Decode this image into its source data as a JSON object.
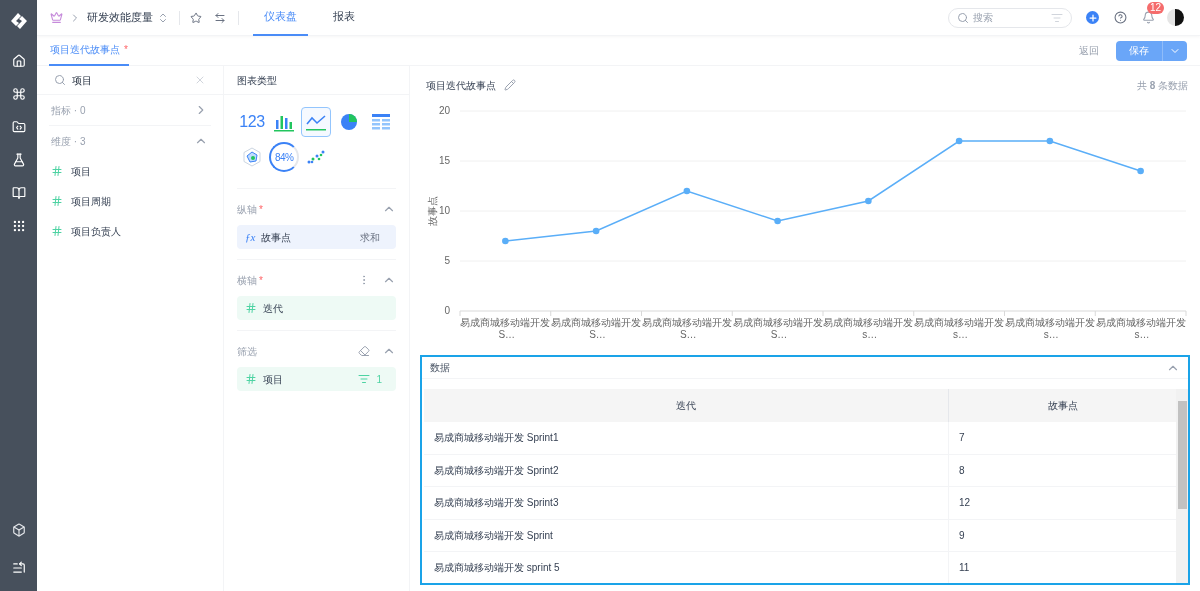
{
  "app_bar": {
    "workspace": "研发效能度量",
    "tabs": [
      {
        "label": "仪表盘",
        "selected": true
      },
      {
        "label": "报表",
        "selected": false
      }
    ],
    "search": {
      "placeholder": "搜索"
    },
    "notification_count": "12"
  },
  "editor_tabs": [
    {
      "label": "项目迭代故事点",
      "mark": "*",
      "selected": true
    }
  ],
  "actions": {
    "back": "返回",
    "save": "保存"
  },
  "field_panel": {
    "search": {
      "value": "项目"
    },
    "groups": [
      {
        "label": "指标 · 0",
        "expanded": false
      },
      {
        "label": "维度 · 3",
        "expanded": true,
        "fields": [
          "项目",
          "项目周期",
          "项目负责人"
        ]
      }
    ]
  },
  "chart_config": {
    "title": "图表类型",
    "chart_types": [
      {
        "kind": "number",
        "label": "123",
        "selected": false
      },
      {
        "kind": "bar",
        "selected": false
      },
      {
        "kind": "line",
        "selected": true
      },
      {
        "kind": "pie",
        "selected": false
      },
      {
        "kind": "table",
        "selected": false
      },
      {
        "kind": "radar",
        "selected": false
      },
      {
        "kind": "gauge",
        "label": "84%",
        "selected": false
      },
      {
        "kind": "scatter",
        "selected": false
      }
    ],
    "sections": [
      {
        "kind": "y_axis",
        "title": "纵轴",
        "mark": "*",
        "expanded": true,
        "function_label": "ƒx",
        "field": "故事点",
        "aggregate": "求和"
      },
      {
        "kind": "x_axis",
        "title": "横轴",
        "mark": "*",
        "expanded": true,
        "field": "迭代"
      },
      {
        "kind": "filter",
        "title": "筛选",
        "expanded": true,
        "field": "项目",
        "count": "1"
      }
    ]
  },
  "chart": {
    "title": "项目迭代故事点",
    "count_text": "共 **8** 条数据",
    "chart_data": {
      "type": "line",
      "ylabel": "故事点",
      "categories": [
        "易成商城移动端开发 S…",
        "易成商城移动端开发 S…",
        "易成商城移动端开发 S…",
        "易成商城移动端开发 S…",
        "易成商城移动端开发 s…",
        "易成商城移动端开发 s…",
        "易成商城移动端开发 s…",
        "易成商城移动端开发 s…"
      ],
      "series": [
        {
          "color": "#5aaef8",
          "marker": true,
          "values": [
            7,
            8,
            12,
            9,
            11,
            17,
            17,
            14
          ]
        }
      ],
      "ylim": [
        0,
        20
      ],
      "yticks": [
        0,
        5,
        10,
        15,
        20
      ],
      "grid": true
    }
  },
  "data_table": {
    "title": "数据",
    "expanded": true,
    "columns": [
      "迭代",
      "故事点"
    ],
    "rows": [
      [
        "易成商城移动端开发 Sprint1",
        "7"
      ],
      [
        "易成商城移动端开发 Sprint2",
        "8"
      ],
      [
        "易成商城移动端开发 Sprint3",
        "12"
      ],
      [
        "易成商城移动端开发 Sprint",
        "9"
      ],
      [
        "易成商城移动端开发 sprint 5",
        "11"
      ]
    ]
  }
}
